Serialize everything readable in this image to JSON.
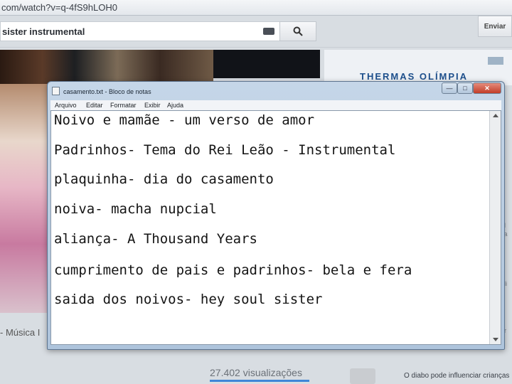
{
  "browser": {
    "url": "com/watch?v=q-4fS9hLOH0",
    "search_query": "sister instrumental",
    "upload_label": "Enviar"
  },
  "youtube": {
    "ad_title": "THERMAS OLÍMPIA",
    "left_caption": "- Música I",
    "view_count": "27.402 visualizações",
    "recommended_title": "O diabo pode influenciar crianças",
    "right_fragments": [
      "c",
      "ol",
      "sa",
      "oli",
      "c",
      "ar"
    ]
  },
  "notepad": {
    "title": "casamento.txt - Bloco de notas",
    "menu": [
      "Arquivo",
      "Editar",
      "Formatar",
      "Exibir",
      "Ajuda"
    ],
    "lines": [
      "Noivo e mamãe - um verso de amor",
      "Padrinhos- Tema do Rei Leão - Instrumental",
      "plaquinha- dia do casamento",
      "noiva- macha nupcial",
      "aliança- A Thousand Years",
      "cumprimento de pais e padrinhos- bela e fera",
      "saida dos noivos- hey soul sister"
    ]
  },
  "icons": {
    "search": "search-icon",
    "keyboard": "keyboard-icon",
    "minimize": "minimize-icon",
    "maximize": "maximize-icon",
    "close": "close-icon"
  }
}
